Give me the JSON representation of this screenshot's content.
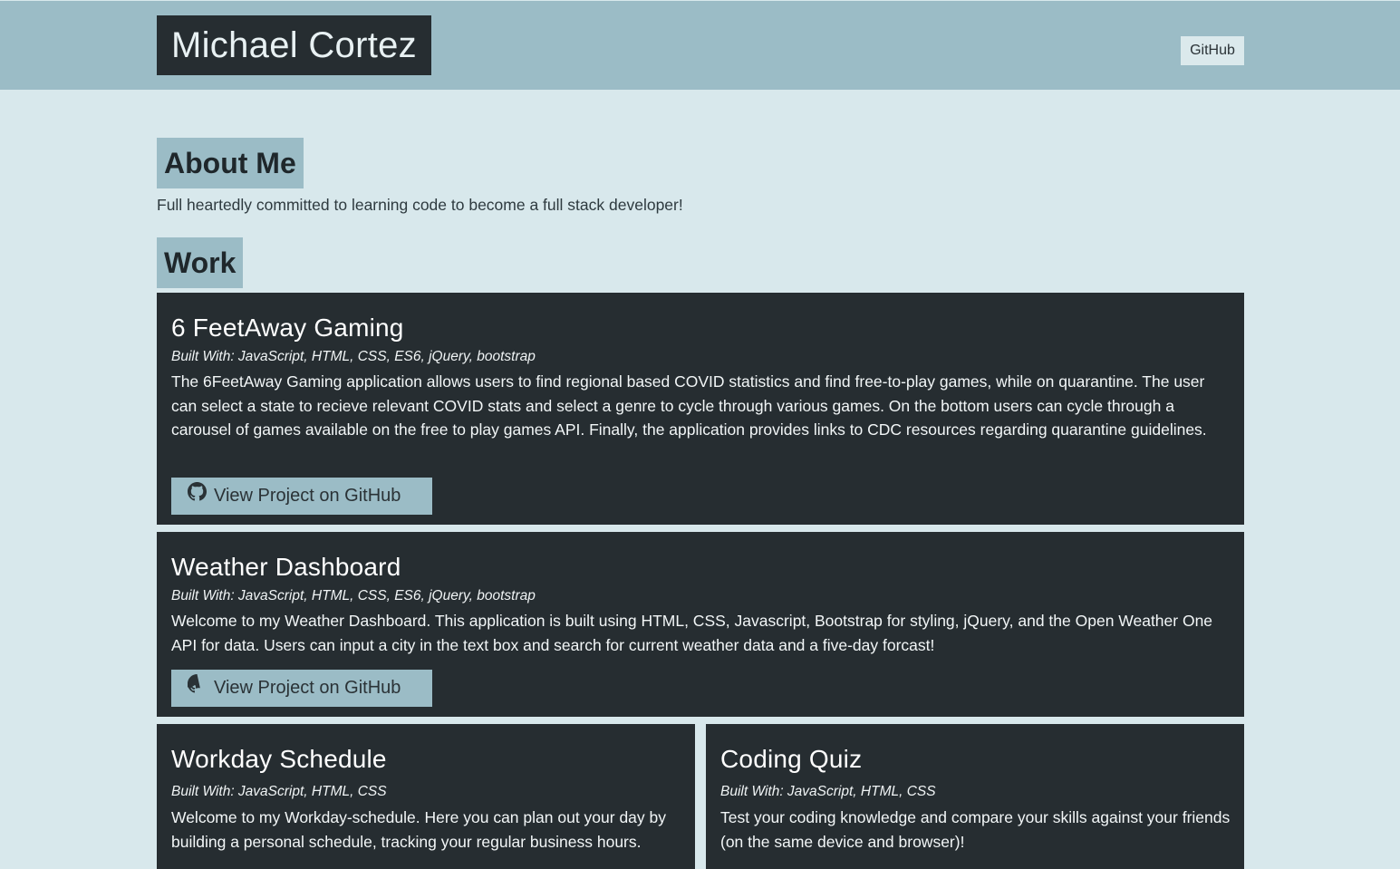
{
  "header": {
    "brand": "Michael Cortez",
    "nav_github": "GitHub"
  },
  "about": {
    "heading": "About Me",
    "text": "Full heartedly committed to learning code to become a full stack developer!"
  },
  "work": {
    "heading": "Work",
    "projects": [
      {
        "title": "6 FeetAway Gaming",
        "built_with": "Built With: JavaScript, HTML, CSS, ES6, jQuery, bootstrap",
        "description": "The 6FeetAway Gaming application allows users to find regional based COVID statistics and find free-to-play games, while on quarantine. The user can select a state to recieve relevant COVID stats and select a genre to cycle through various games. On the bottom users can cycle through a carousel of games available on the free to play games API. Finally, the application provides links to CDC resources regarding quarantine guidelines.",
        "button": "View Project on GitHub"
      },
      {
        "title": "Weather Dashboard",
        "built_with": "Built With: JavaScript, HTML, CSS, ES6, jQuery, bootstrap",
        "description": "Welcome to my Weather Dashboard. This application is built using HTML, CSS, Javascript, Bootstrap for styling, jQuery, and the Open Weather One API for data. Users can input a city in the text box and search for current weather data and a five-day forcast!",
        "button": "View Project on GitHub"
      },
      {
        "title": "Workday Schedule",
        "built_with": "Built With: JavaScript, HTML, CSS",
        "description": "Welcome to my Workday-schedule. Here you can plan out your day by building a personal schedule, tracking your regular business hours."
      },
      {
        "title": "Coding Quiz",
        "built_with": "Built With: JavaScript, HTML, CSS",
        "description": "Test your coding knowledge and compare your skills against your friends (on the same device and browser)!"
      }
    ]
  },
  "colors": {
    "header_bg": "#9bbcc6",
    "page_bg": "#d8e8ec",
    "card_bg": "#262d31",
    "button_bg": "#9bbcc6"
  },
  "icons": {
    "button_icon": "github-icon"
  }
}
